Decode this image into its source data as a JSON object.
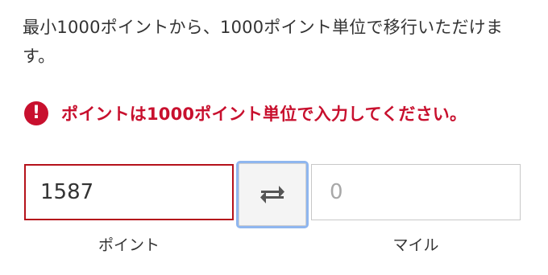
{
  "description": "最小1000ポイントから、1000ポイント単位で移行いただけます。",
  "error": {
    "icon": "exclamation-circle-icon",
    "icon_glyph": "!",
    "message": "ポイントは1000ポイント単位で入力してください。",
    "color": "#c8102e"
  },
  "conversion": {
    "points_value": "1587",
    "points_label": "ポイント",
    "swap_icon": "swap-arrows-icon",
    "miles_placeholder": "0",
    "miles_label": "マイル"
  }
}
